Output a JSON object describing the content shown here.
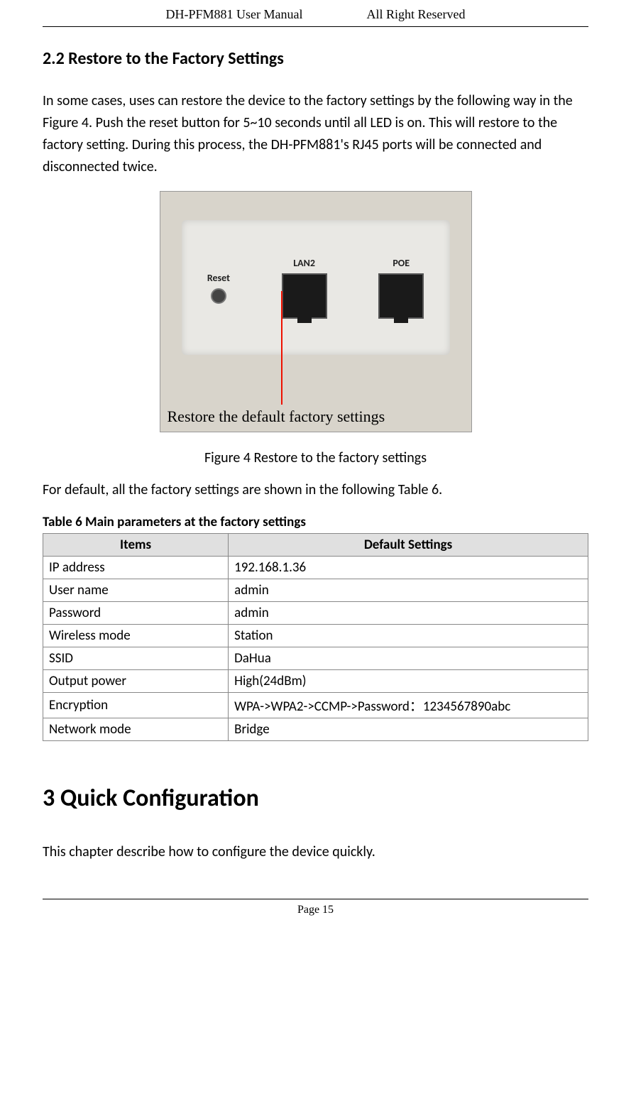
{
  "header": {
    "left": "DH-PFM881 User Manual",
    "right": "All Right Reserved"
  },
  "section_2_2": {
    "heading": "2.2  Restore to the Factory Settings",
    "paragraph": "In some cases, uses can restore the device to the factory settings by the following way in the Figure 4. Push the reset button for 5~10 seconds until all LED is on. This will restore to the factory setting. During this process, the DH-PFM881's RJ45 ports will be connected and disconnected twice."
  },
  "figure4": {
    "reset_label": "Reset",
    "lan2_label": "LAN2",
    "poe_label": "POE",
    "overlay_caption": "Restore the default factory settings",
    "caption": "Figure 4 Restore to the factory settings"
  },
  "paragraph_after_figure": "For default, all the factory settings are shown in the following Table 6.",
  "table6": {
    "title": "Table 6 Main parameters at the factory settings",
    "head_items": "Items",
    "head_default": "Default Settings",
    "rows": [
      {
        "item": "IP address",
        "value": "192.168.1.36"
      },
      {
        "item": "User name",
        "value": "admin"
      },
      {
        "item": "Password",
        "value": "admin"
      },
      {
        "item": "Wireless mode",
        "value": "Station"
      },
      {
        "item": "SSID",
        "value": "DaHua"
      },
      {
        "item": "Output power",
        "value": "High(24dBm)"
      },
      {
        "item": "Encryption",
        "value": "WPA->WPA2->CCMP->Password：1234567890abc"
      },
      {
        "item": "Network mode",
        "value": "Bridge"
      }
    ]
  },
  "chapter3": {
    "heading": "3  Quick Configuration",
    "paragraph": "This chapter describe how to configure the device quickly."
  },
  "footer": {
    "page_label": "Page 15"
  }
}
